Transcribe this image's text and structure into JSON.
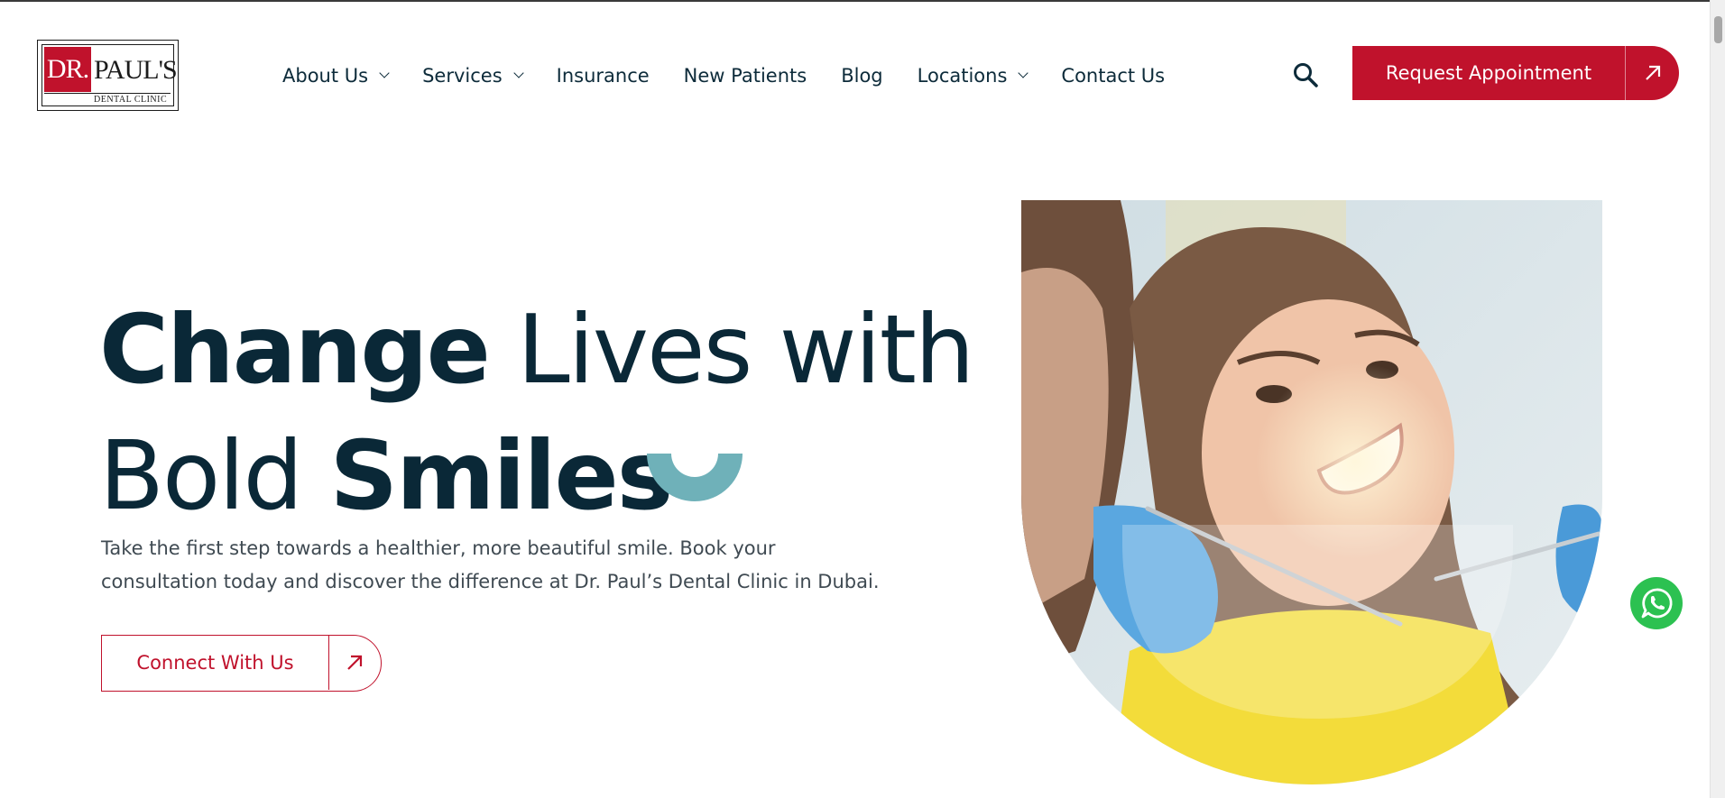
{
  "brand": {
    "logo_main_left": "DR.",
    "logo_main_right": "PAUL'S",
    "logo_sub": "DENTAL CLINIC",
    "accent_color": "#c0122c",
    "teal_color": "#6fb1b9"
  },
  "nav": {
    "items": [
      {
        "label": "About Us",
        "has_dropdown": true
      },
      {
        "label": "Services",
        "has_dropdown": true
      },
      {
        "label": "Insurance",
        "has_dropdown": false
      },
      {
        "label": "New Patients",
        "has_dropdown": false
      },
      {
        "label": "Blog",
        "has_dropdown": false
      },
      {
        "label": "Locations",
        "has_dropdown": true
      },
      {
        "label": "Contact Us",
        "has_dropdown": false
      }
    ],
    "search_icon": "search-icon",
    "cta_label": "Request Appointment",
    "cta_icon": "arrow-up-right-icon"
  },
  "hero": {
    "headline_word1": "Change",
    "headline_word2": " Lives with",
    "headline_word3": "Bold ",
    "headline_word4": "Smiles",
    "subtext": "Take the first step towards a healthier, more beautiful smile. Book your consultation today and discover the difference at Dr. Paul’s Dental Clinic in Dubai.",
    "button_label": "Connect With Us",
    "button_icon": "arrow-up-right-icon"
  },
  "floating": {
    "whatsapp_icon": "whatsapp-icon"
  }
}
